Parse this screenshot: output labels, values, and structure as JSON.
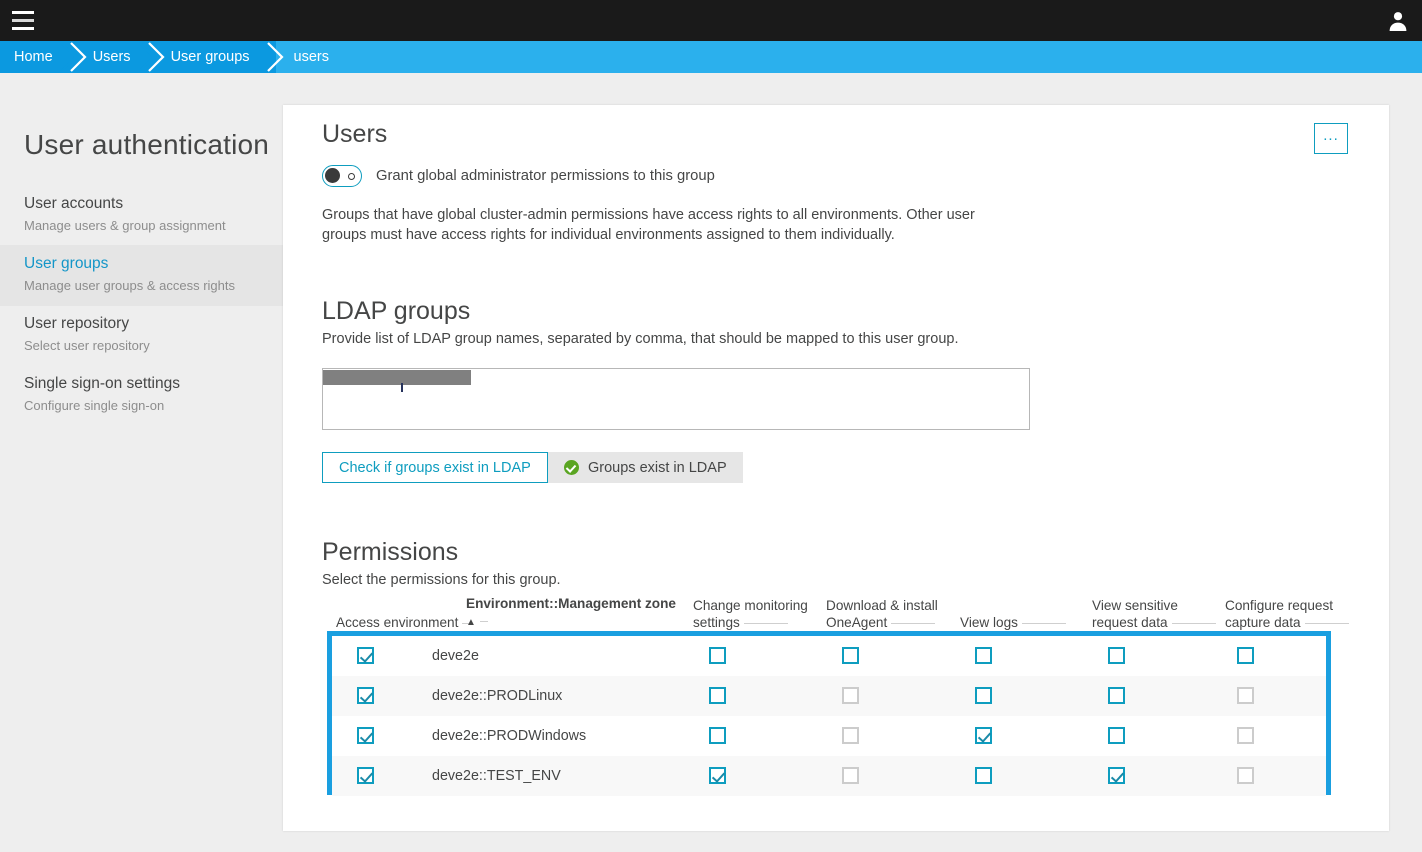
{
  "topbar": {
    "menu_icon": "hamburger-icon",
    "avatar_icon": "user-icon"
  },
  "breadcrumb": {
    "items": [
      {
        "label": "Home"
      },
      {
        "label": "Users"
      },
      {
        "label": "User groups"
      },
      {
        "label": "users"
      }
    ]
  },
  "sidebar": {
    "title": "User authentication",
    "items": [
      {
        "title": "User accounts",
        "subtitle": "Manage users & group assignment",
        "active": false
      },
      {
        "title": "User groups",
        "subtitle": "Manage user groups & access rights",
        "active": true
      },
      {
        "title": "User repository",
        "subtitle": "Select user repository",
        "active": false
      },
      {
        "title": "Single sign-on settings",
        "subtitle": "Configure single sign-on",
        "active": false
      }
    ]
  },
  "main": {
    "heading": "Users",
    "more_button_label": "...",
    "toggle": {
      "label": "Grant global administrator permissions to this group",
      "state": "off"
    },
    "global_description": "Groups that have global cluster-admin permissions have access rights to all environments. Other user groups must have access rights for individual environments assigned to them individually.",
    "ldap": {
      "heading": "LDAP groups",
      "description": "Provide list of LDAP group names, separated by comma, that should be mapped to this user group.",
      "textarea_value": "",
      "textarea_placeholder": "",
      "check_button_label": "Check if groups exist in LDAP",
      "status_label": "Groups exist in LDAP",
      "status_icon": "green-check-icon"
    },
    "permissions": {
      "heading": "Permissions",
      "description": "Select the permissions for this group.",
      "columns": [
        {
          "label": "Access environment",
          "bold": false,
          "sorted": false
        },
        {
          "label": "Environment::Management zone",
          "bold": true,
          "sorted": true,
          "sort_direction": "asc"
        },
        {
          "label": "Change monitoring settings",
          "bold": false,
          "sorted": false
        },
        {
          "label": "Download & install OneAgent",
          "bold": false,
          "sorted": false
        },
        {
          "label": "View logs",
          "bold": false,
          "sorted": false
        },
        {
          "label": "View sensitive request data",
          "bold": false,
          "sorted": false
        },
        {
          "label": "Configure request capture data",
          "bold": false,
          "sorted": false
        }
      ],
      "rows": [
        {
          "name": "deve2e",
          "access_environment": "checked",
          "change_monitoring_settings": "unchecked",
          "download_install_oneagent": "unchecked",
          "view_logs": "unchecked",
          "view_sensitive_request_data": "unchecked",
          "configure_request_capture_data": "unchecked"
        },
        {
          "name": "deve2e::PRODLinux",
          "access_environment": "checked",
          "change_monitoring_settings": "unchecked",
          "download_install_oneagent": "disabled",
          "view_logs": "unchecked",
          "view_sensitive_request_data": "unchecked",
          "configure_request_capture_data": "disabled"
        },
        {
          "name": "deve2e::PRODWindows",
          "access_environment": "checked",
          "change_monitoring_settings": "unchecked",
          "download_install_oneagent": "disabled",
          "view_logs": "checked",
          "view_sensitive_request_data": "unchecked",
          "configure_request_capture_data": "disabled"
        },
        {
          "name": "deve2e::TEST_ENV",
          "access_environment": "checked",
          "change_monitoring_settings": "checked",
          "download_install_oneagent": "disabled",
          "view_logs": "unchecked",
          "view_sensitive_request_data": "checked",
          "configure_request_capture_data": "disabled"
        }
      ]
    }
  },
  "colors": {
    "breadcrumb_bg": "#2bb0ed",
    "breadcrumb_item": "#0b99e0",
    "accent_teal": "#0e9dbf",
    "accent_link": "#1496c8",
    "highlight_border": "#1a9fe0",
    "success_green": "#5aa522",
    "topbar_bg": "#1a1a1a",
    "page_bg": "#eeeeee"
  }
}
